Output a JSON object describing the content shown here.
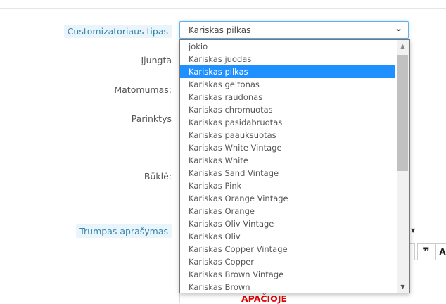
{
  "form": {
    "customizer_label": "Customizatoriaus tipas",
    "enabled_label": "Įjungta",
    "visibility_label": "Matomumas:",
    "options_label": "Parinktys",
    "condition_label": "Būklė:",
    "short_description_label": "Trumpas aprašymas",
    "customizer_value": "Kariskas pilkas",
    "bottom_text": "APAČIOJE"
  },
  "dropdown": {
    "selected_index": 2,
    "options": [
      "jokio",
      "Kariskas juodas",
      "Kariskas pilkas",
      "Kariskas geltonas",
      "Kariskas raudonas",
      "Kariskas chromuotas",
      "Kariskas pasidabruotas",
      "Kariskas paauksuotas",
      "Kariskas White Vintage",
      "Kariskas White",
      "Kariskas Sand Vintage",
      "Kariskas Pink",
      "Kariskas Orange Vintage",
      "Kariskas Orange",
      "Kariskas Oliv Vintage",
      "Kariskas Oliv",
      "Kariskas Copper Vintage",
      "Kariskas Copper",
      "Kariskas Brown Vintage",
      "Kariskas Brown"
    ]
  },
  "editor": {
    "quote_icon": "❞",
    "format_glyph": "A"
  },
  "colors": {
    "selected": "#1e90ff",
    "accent_label": "#3586ae",
    "bottom_text": "#e00000"
  }
}
